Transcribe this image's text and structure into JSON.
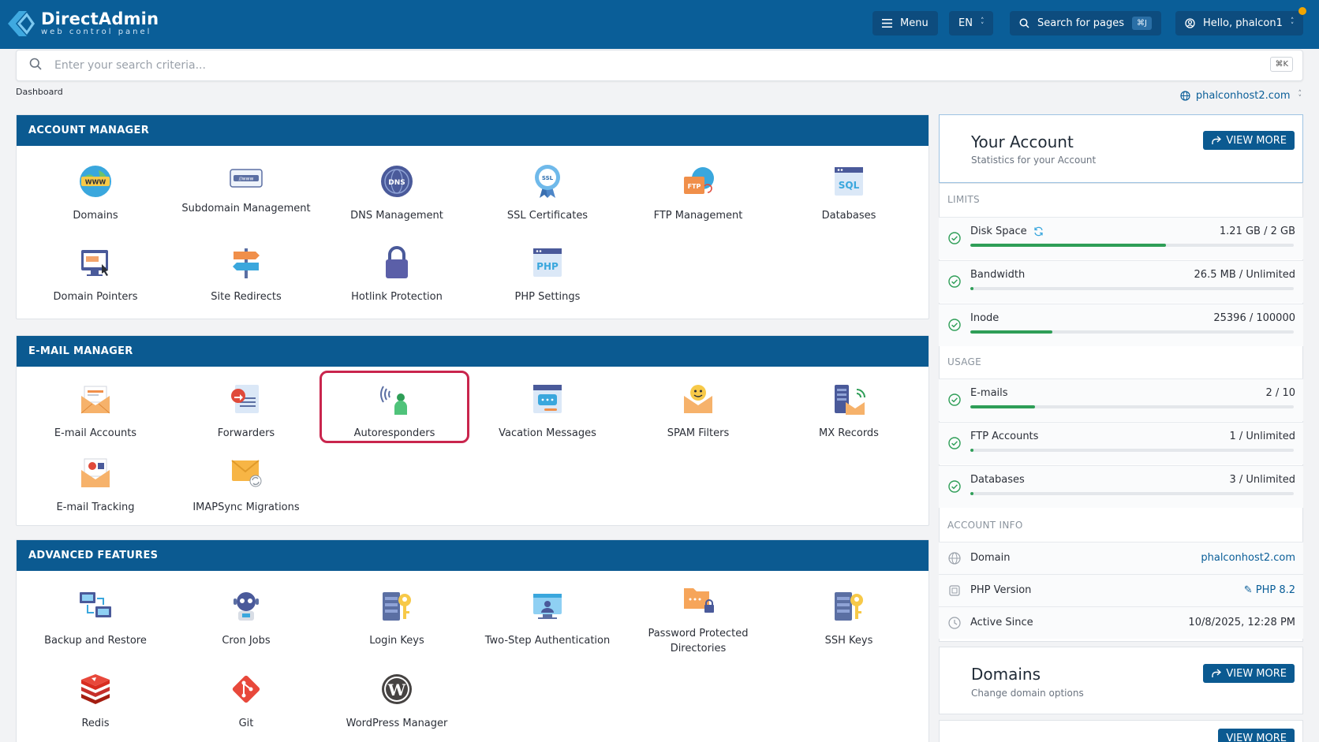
{
  "header": {
    "brand_title": "DirectAdmin",
    "brand_subtitle": "web control panel",
    "menu_label": "Menu",
    "language": "EN",
    "search_pages_label": "Search for pages",
    "search_pages_shortcut": "⌘J",
    "user_greeting": "Hello, phalcon1"
  },
  "search": {
    "placeholder": "Enter your search criteria...",
    "shortcut": "⌘K"
  },
  "breadcrumb": "Dashboard",
  "current_domain": "phalconhost2.com",
  "account_manager": {
    "title": "ACCOUNT MANAGER",
    "items": [
      {
        "label": "Domains",
        "icon": "www-globe-icon"
      },
      {
        "label": "Subdomain Management",
        "icon": "subdomain-icon"
      },
      {
        "label": "DNS Management",
        "icon": "dns-icon"
      },
      {
        "label": "SSL Certificates",
        "icon": "ssl-badge-icon"
      },
      {
        "label": "FTP Management",
        "icon": "ftp-folder-icon"
      },
      {
        "label": "Databases",
        "icon": "sql-database-icon"
      },
      {
        "label": "Domain Pointers",
        "icon": "domain-pointer-icon"
      },
      {
        "label": "Site Redirects",
        "icon": "signpost-icon"
      },
      {
        "label": "Hotlink Protection",
        "icon": "padlock-icon"
      },
      {
        "label": "PHP Settings",
        "icon": "php-icon"
      }
    ]
  },
  "email_manager": {
    "title": "E-MAIL MANAGER",
    "items": [
      {
        "label": "E-mail Accounts",
        "icon": "envelope-icon"
      },
      {
        "label": "Forwarders",
        "icon": "forward-mail-icon"
      },
      {
        "label": "Autoresponders",
        "icon": "autoresponder-icon"
      },
      {
        "label": "Vacation Messages",
        "icon": "vacation-message-icon"
      },
      {
        "label": "SPAM Filters",
        "icon": "spam-filter-icon"
      },
      {
        "label": "MX Records",
        "icon": "mx-records-icon"
      },
      {
        "label": "E-mail Tracking",
        "icon": "email-tracking-icon"
      },
      {
        "label": "IMAPSync Migrations",
        "icon": "imap-sync-icon"
      }
    ]
  },
  "advanced_features": {
    "title": "ADVANCED FEATURES",
    "items": [
      {
        "label": "Backup and Restore",
        "icon": "backup-icon"
      },
      {
        "label": "Cron Jobs",
        "icon": "cron-robot-icon"
      },
      {
        "label": "Login Keys",
        "icon": "login-keys-icon"
      },
      {
        "label": "Two-Step Authentication",
        "icon": "two-step-auth-icon"
      },
      {
        "label": "Password Protected Directories",
        "icon": "protected-folder-icon"
      },
      {
        "label": "SSH Keys",
        "icon": "ssh-keys-icon"
      },
      {
        "label": "Redis",
        "icon": "redis-icon"
      },
      {
        "label": "Git",
        "icon": "git-icon"
      },
      {
        "label": "WordPress Manager",
        "icon": "wordpress-icon"
      }
    ]
  },
  "account_card": {
    "title": "Your Account",
    "subtitle": "Statistics for your Account",
    "view_more": "VIEW MORE",
    "limits_label": "LIMITS",
    "usage_label": "USAGE",
    "info_label": "ACCOUNT INFO",
    "limits": [
      {
        "name": "Disk Space",
        "value": "1.21 GB / 2 GB",
        "percent": 60.5
      },
      {
        "name": "Bandwidth",
        "value": "26.5 MB / Unlimited",
        "percent": 1
      },
      {
        "name": "Inode",
        "value": "25396 / 100000",
        "percent": 25.4
      }
    ],
    "usage": [
      {
        "name": "E-mails",
        "value": "2 / 10",
        "percent": 20
      },
      {
        "name": "FTP Accounts",
        "value": "1 / Unlimited",
        "percent": 1
      },
      {
        "name": "Databases",
        "value": "3 / Unlimited",
        "percent": 1
      }
    ],
    "info": [
      {
        "name": "Domain",
        "value": "phalconhost2.com"
      },
      {
        "name": "PHP Version",
        "value": "PHP 8.2"
      },
      {
        "name": "Active Since",
        "value": "10/8/2025, 12:28 PM"
      }
    ]
  },
  "domains_card": {
    "title": "Domains",
    "subtitle": "Change domain options",
    "view_more": "VIEW MORE"
  },
  "colors": {
    "header_blue": "#0a5e98",
    "panel_head": "#0b5a91",
    "progress_green": "#2e9e57",
    "highlight_border": "#c9254d"
  }
}
